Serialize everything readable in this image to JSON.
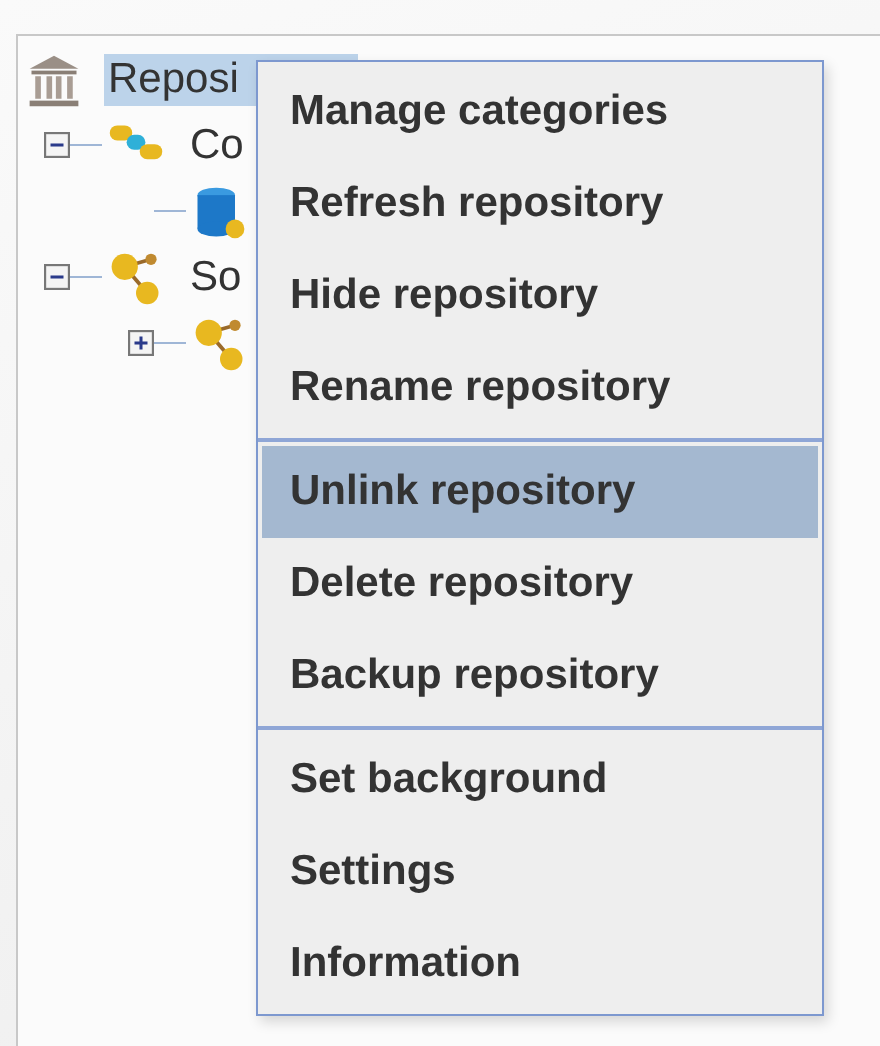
{
  "tree": {
    "root": {
      "kind": "repository",
      "label": "Reposi",
      "selected": true,
      "children": [
        {
          "kind": "connections",
          "label": "Co",
          "expanded": true,
          "children": [
            {
              "kind": "database"
            }
          ]
        },
        {
          "kind": "sources",
          "label": "So",
          "expanded": true,
          "children": [
            {
              "kind": "sources",
              "expanded": false
            }
          ]
        }
      ]
    }
  },
  "context_menu": {
    "groups": [
      {
        "items": [
          {
            "label": "Manage categories",
            "selected": false
          },
          {
            "label": "Refresh repository",
            "selected": false
          },
          {
            "label": "Hide repository",
            "selected": false
          },
          {
            "label": "Rename repository",
            "selected": false
          }
        ]
      },
      {
        "items": [
          {
            "label": "Unlink repository",
            "selected": true
          },
          {
            "label": "Delete repository",
            "selected": false
          },
          {
            "label": "Backup repository",
            "selected": false
          }
        ]
      },
      {
        "items": [
          {
            "label": "Set background",
            "selected": false
          },
          {
            "label": "Settings",
            "selected": false
          },
          {
            "label": "Information",
            "selected": false
          }
        ]
      }
    ]
  }
}
